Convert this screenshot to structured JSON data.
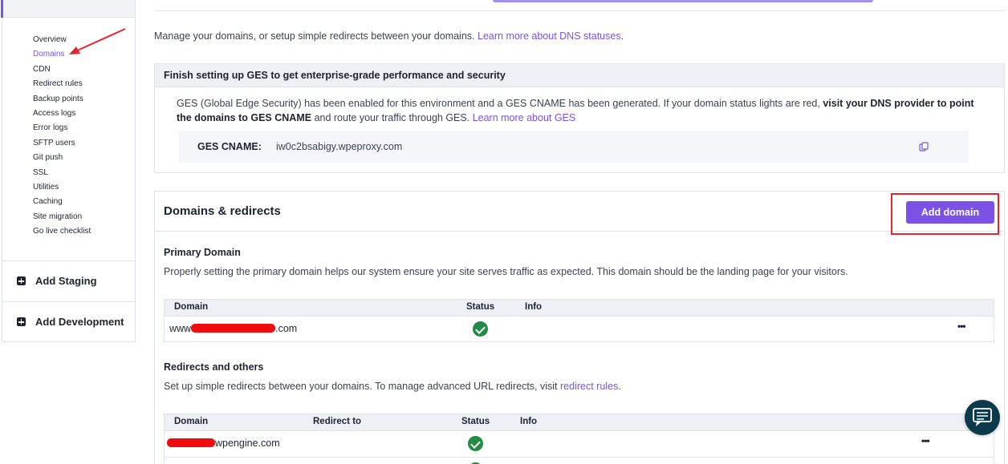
{
  "sidebar": {
    "items": [
      {
        "label": "Overview",
        "active": false
      },
      {
        "label": "Domains",
        "active": true
      },
      {
        "label": "CDN",
        "active": false
      },
      {
        "label": "Redirect rules",
        "active": false
      },
      {
        "label": "Backup points",
        "active": false
      },
      {
        "label": "Access logs",
        "active": false
      },
      {
        "label": "Error logs",
        "active": false
      },
      {
        "label": "SFTP users",
        "active": false
      },
      {
        "label": "Git push",
        "active": false
      },
      {
        "label": "SSL",
        "active": false
      },
      {
        "label": "Utilities",
        "active": false
      },
      {
        "label": "Caching",
        "active": false
      },
      {
        "label": "Site migration",
        "active": false
      },
      {
        "label": "Go live checklist",
        "active": false
      }
    ],
    "add_staging": "Add Staging",
    "add_development": "Add Development"
  },
  "intro": {
    "text": "Manage your domains, or setup simple redirects between your domains.",
    "link": "Learn more about DNS statuses",
    "suffix": "."
  },
  "ges": {
    "title": "Finish setting up GES to get enterprise-grade performance and security",
    "body_pre": "GES (Global Edge Security) has been enabled for this environment and a GES CNAME has been generated. If your domain status lights are red,",
    "body_bold": "visit your DNS provider to point the domains to GES CNAME",
    "body_post": "and route your traffic through GES.",
    "body_link": "Learn more about GES",
    "cname_label": "GES CNAME:",
    "cname_value": "iw0c2bsabigy.wpeproxy.com"
  },
  "domains": {
    "title": "Domains & redirects",
    "add_button": "Add domain",
    "primary": {
      "title": "Primary Domain",
      "description": "Properly setting the primary domain helps our system ensure your site serves traffic as expected. This domain should be the landing page for your visitors.",
      "columns": [
        "Domain",
        "Status",
        "Info"
      ],
      "rows": [
        {
          "domain_prefix": "www",
          "domain_suffix": ".com",
          "status": "ok",
          "info": ""
        }
      ]
    },
    "redirects": {
      "title": "Redirects and others",
      "description": "Set up simple redirects between your domains. To manage advanced URL redirects, visit",
      "link": "redirect rules",
      "suffix": ".",
      "columns": [
        "Domain",
        "Redirect to",
        "Status",
        "Info"
      ],
      "rows": [
        {
          "domain_prefix": "",
          "domain_suffix": "wpengine.com",
          "redirect_to": "",
          "status": "ok",
          "info": ""
        }
      ]
    },
    "more_label": "•••"
  },
  "colors": {
    "accent": "#7b52e5",
    "success": "#228b44",
    "annotation": "#e4262f"
  }
}
